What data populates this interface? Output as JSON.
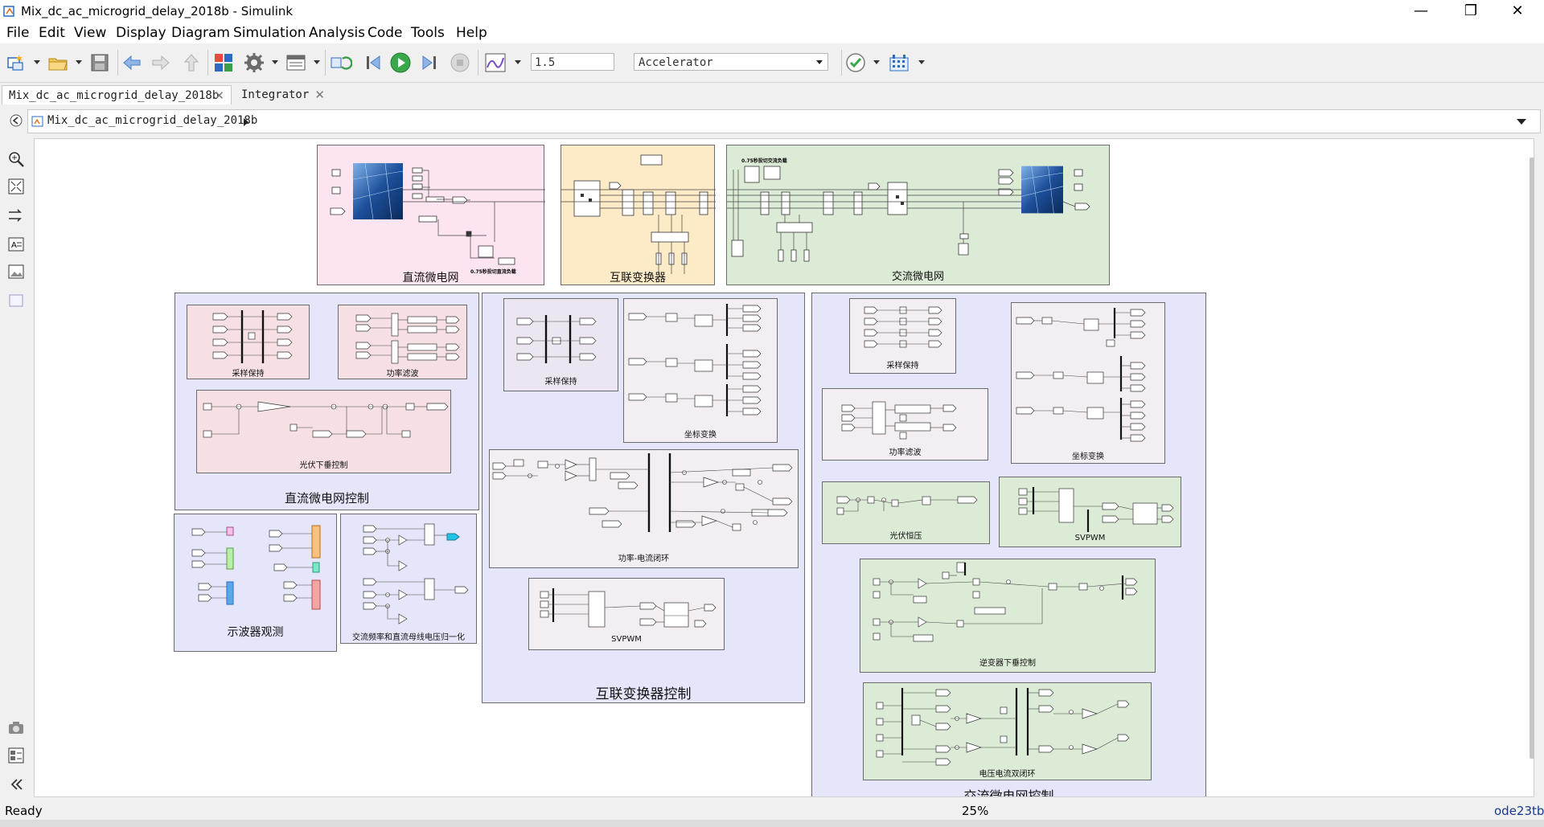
{
  "window": {
    "title": "Mix_dc_ac_microgrid_delay_2018b - Simulink",
    "minimize": "—",
    "restore": "❐",
    "close": "✕"
  },
  "menu": [
    "File",
    "Edit",
    "View",
    "Display",
    "Diagram",
    "Simulation",
    "Analysis",
    "Code",
    "Tools",
    "Help"
  ],
  "toolbar": {
    "stop_time": "1.5",
    "sim_mode": "Accelerator",
    "icons": [
      "new-model-icon",
      "open-icon",
      "save-icon",
      "back-icon",
      "forward-icon",
      "up-icon",
      "library-browser-icon",
      "model-settings-icon",
      "model-explorer-icon",
      "update-diagram-icon",
      "step-back-icon",
      "run-icon",
      "step-forward-icon",
      "stop-icon",
      "data-inspector-icon",
      "model-advisor-icon",
      "build-icon"
    ]
  },
  "tabs": [
    {
      "label": "Mix_dc_ac_microgrid_delay_2018b"
    },
    {
      "label": "Integrator"
    }
  ],
  "breadcrumb": "Mix_dc_ac_microgrid_delay_2018b",
  "diagram": {
    "areas": {
      "dc_grid": "直流微电网",
      "interlink_converter": "互联变换器",
      "ac_grid": "交流微电网",
      "dc_grid_control": "直流微电网控制",
      "interlink_control": "互联变换器控制",
      "ac_grid_control": "交流微电网控制",
      "scope_observe": "示波器观测"
    },
    "subsystems": {
      "dc_sample_hold": "采样保持",
      "dc_power_filter": "功率滤波",
      "pv_droop": "光伏下垂控制",
      "normalization": "交流频率和直流母线电压归一化",
      "ic_sample_hold": "采样保持",
      "ic_coord_transform": "坐标变换",
      "ic_power_current_loop": "功率-电流闭环",
      "ic_svpwm": "SVPWM",
      "ac_sample_hold": "采样保持",
      "ac_power_filter": "功率滤波",
      "ac_coord_transform": "坐标变换",
      "pv_boost": "光伏恒压",
      "ac_svpwm": "SVPWM",
      "inverter_droop": "逆变器下垂控制",
      "vi_double_loop": "电压电流双闭环"
    },
    "small_notes": {
      "dc_load_note": "0.75秒投切直流负载",
      "ac_load_note": "0.75秒投切交流负载"
    }
  },
  "status": {
    "state": "Ready",
    "zoom": "25%",
    "solver": "ode23tb"
  }
}
